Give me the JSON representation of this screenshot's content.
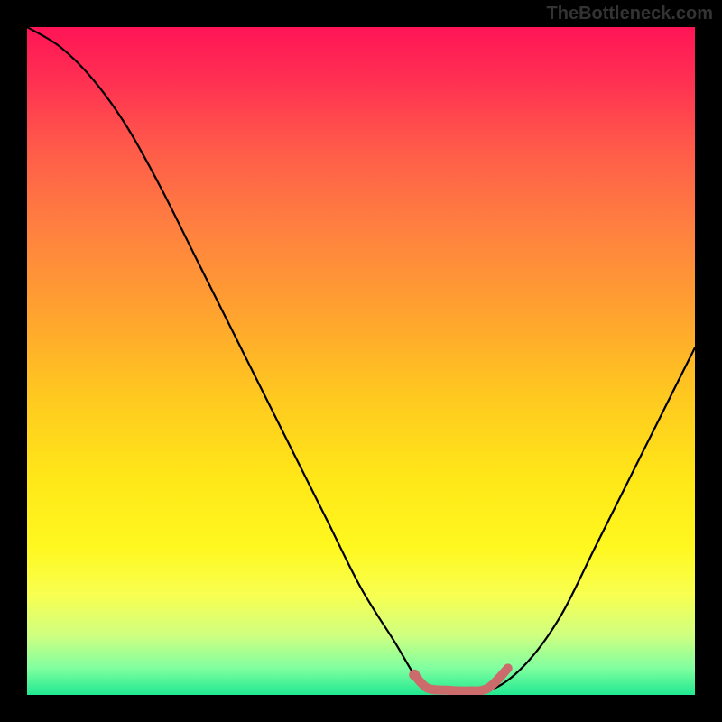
{
  "watermark": "TheBottleneck.com",
  "chart_data": {
    "type": "line",
    "title": "",
    "xlabel": "",
    "ylabel": "",
    "xlim": [
      0,
      100
    ],
    "ylim": [
      0,
      100
    ],
    "grid": false,
    "legend": false,
    "series": [
      {
        "name": "bottleneck-curve",
        "color": "#000000",
        "x": [
          0,
          5,
          10,
          15,
          20,
          25,
          30,
          35,
          40,
          45,
          50,
          55,
          58,
          60,
          65,
          70,
          75,
          80,
          85,
          90,
          95,
          100
        ],
        "values": [
          100,
          97,
          92,
          85,
          76,
          66,
          56,
          46,
          36,
          26,
          16,
          8,
          3,
          1,
          0.5,
          1,
          5,
          12,
          22,
          32,
          42,
          52
        ]
      },
      {
        "name": "highlight-segment",
        "color": "#cc6b6b",
        "x": [
          58,
          60,
          63,
          66,
          69,
          72
        ],
        "values": [
          3,
          1,
          0.7,
          0.6,
          1,
          4
        ]
      }
    ]
  }
}
